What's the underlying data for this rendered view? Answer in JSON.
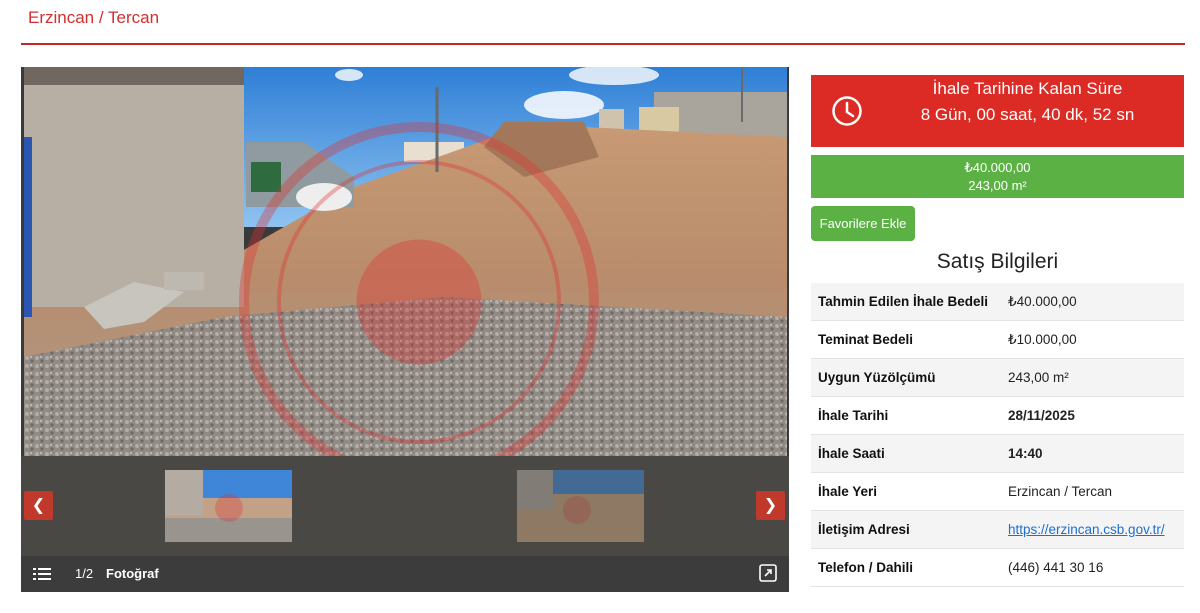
{
  "header": {
    "breadcrumb": "Erzincan / Tercan"
  },
  "gallery": {
    "counter": "1/2",
    "caption": "Fotoğraf",
    "thumbnail_count": 2,
    "icons": [
      "list-icon",
      "chevron-left-icon",
      "chevron-right-icon",
      "expand-icon"
    ]
  },
  "countdown": {
    "label": "İhale Tarihine Kalan Süre",
    "value": "8 Gün, 00 saat, 40 dk, 52 sn",
    "icon": "clock-icon",
    "bg_color": "#dc2b24"
  },
  "price": {
    "amount": "₺40.000,00",
    "area": "243,00 m²",
    "bg_color": "#5cb145"
  },
  "favorite_button": {
    "label": "Favorilere Ekle"
  },
  "sale_info": {
    "title": "Satış Bilgileri",
    "rows": [
      {
        "label": "Tahmin Edilen İhale Bedeli",
        "value": "₺40.000,00"
      },
      {
        "label": "Teminat Bedeli",
        "value": "₺10.000,00"
      },
      {
        "label": "Uygun Yüzölçümü",
        "value": "243,00 m²"
      },
      {
        "label": "İhale Tarihi",
        "value": "28/11/2025"
      },
      {
        "label": "İhale Saati",
        "value": "14:40"
      },
      {
        "label": "İhale Yeri",
        "value": "Erzincan / Tercan"
      },
      {
        "label": "İletişim Adresi",
        "value": "https://erzincan.csb.gov.tr/"
      },
      {
        "label": "Telefon / Dahili",
        "value": "(446) 441 30 16"
      }
    ]
  }
}
